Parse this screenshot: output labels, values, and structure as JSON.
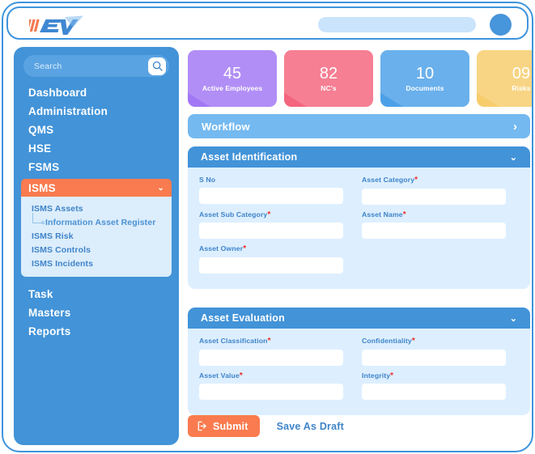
{
  "app": {
    "logo_text": "EV",
    "logo_icon": "ev-logo-icon",
    "accent_blue": "#4293d8",
    "accent_orange": "#f97b4f"
  },
  "topbar": {
    "search_pill_value": "",
    "avatar_icon": "user-avatar-icon"
  },
  "sidebar": {
    "search": {
      "placeholder": "Search",
      "value": "",
      "icon": "search-icon"
    },
    "items": [
      {
        "label": "Dashboard"
      },
      {
        "label": "Administration"
      },
      {
        "label": "QMS"
      },
      {
        "label": "HSE"
      },
      {
        "label": "FSMS"
      },
      {
        "label": "ISMS",
        "active": true,
        "chevron": "⌄"
      }
    ],
    "submenu": [
      {
        "label": "ISMS Assets",
        "child": false
      },
      {
        "label": "Information Asset Register",
        "child": true
      },
      {
        "label": "ISMS Risk",
        "child": false
      },
      {
        "label": "ISMS Controls",
        "child": false
      },
      {
        "label": "ISMS Incidents",
        "child": false
      }
    ],
    "bottom_items": [
      {
        "label": "Task"
      },
      {
        "label": "Masters"
      },
      {
        "label": "Reports"
      }
    ]
  },
  "stats": [
    {
      "value": "45",
      "label": "Active Employees",
      "color": "#a277f5"
    },
    {
      "value": "82",
      "label": "NC's",
      "color": "#f4657e"
    },
    {
      "value": "10",
      "label": "Documents",
      "color": "#4ca0e8"
    },
    {
      "value": "09",
      "label": "Risks",
      "color": "#f7cd6c"
    }
  ],
  "workflow": {
    "label": "Workflow",
    "arrow": "›"
  },
  "panels": [
    {
      "title": "Asset Identification",
      "chevron": "⌄",
      "rows": [
        [
          {
            "label": "S No",
            "required": false,
            "value": ""
          },
          {
            "label": "Asset Category",
            "required": true,
            "value": ""
          }
        ],
        [
          {
            "label": "Asset Sub Category",
            "required": true,
            "value": ""
          },
          {
            "label": "Asset Name",
            "required": true,
            "value": ""
          }
        ],
        [
          {
            "label": "Asset Owner",
            "required": true,
            "value": ""
          },
          {
            "label": "",
            "empty": true
          }
        ]
      ]
    },
    {
      "title": "Asset Evaluation",
      "chevron": "⌄",
      "rows": [
        [
          {
            "label": "Asset Classification",
            "required": true,
            "value": ""
          },
          {
            "label": "Confidentiality",
            "required": true,
            "value": ""
          }
        ],
        [
          {
            "label": "Asset Value",
            "required": true,
            "value": ""
          },
          {
            "label": "Integrity",
            "required": true,
            "value": ""
          }
        ]
      ]
    }
  ],
  "actions": {
    "submit_label": "Submit",
    "submit_icon": "sign-in-arrow-icon",
    "draft_label": "Save As Draft"
  }
}
